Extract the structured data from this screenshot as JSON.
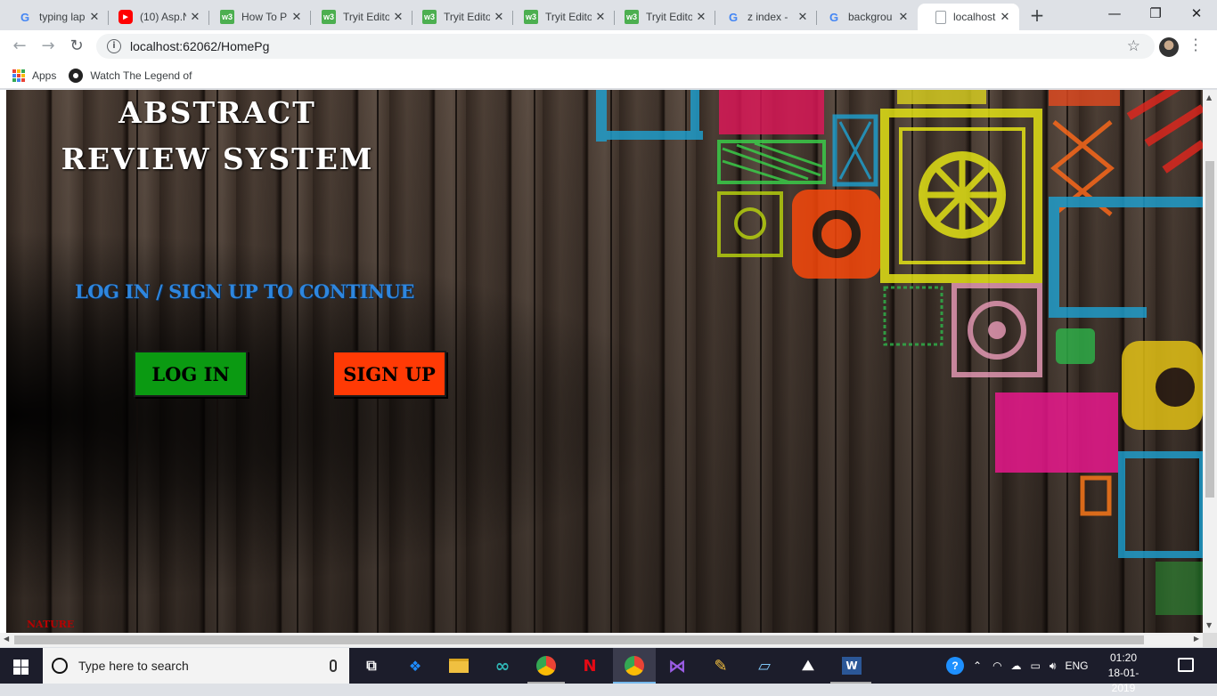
{
  "browser": {
    "tabs": [
      {
        "title": "typing lap",
        "favicon": "google-icon",
        "color": "#4285f4"
      },
      {
        "title": "(10) Asp.N",
        "favicon": "youtube-icon",
        "color": "#ff0000"
      },
      {
        "title": "How To P",
        "favicon": "w3schools-icon",
        "color": "#4caf50"
      },
      {
        "title": "Tryit Edito",
        "favicon": "w3schools-icon",
        "color": "#4caf50"
      },
      {
        "title": "Tryit Edito",
        "favicon": "w3schools-icon",
        "color": "#4caf50"
      },
      {
        "title": "Tryit Edito",
        "favicon": "w3schools-icon",
        "color": "#4caf50"
      },
      {
        "title": "Tryit Edito",
        "favicon": "w3schools-icon",
        "color": "#4caf50"
      },
      {
        "title": "z index -",
        "favicon": "google-icon",
        "color": "#4285f4"
      },
      {
        "title": "backgrou",
        "favicon": "google-icon",
        "color": "#4285f4"
      },
      {
        "title": "localhost",
        "favicon": "page-icon",
        "color": "#9aa0a6",
        "active": true
      }
    ],
    "new_tab": "+",
    "window_controls": {
      "minimize": "—",
      "maximize": "❐",
      "close": "✕"
    },
    "url": "localhost:62062/HomePg",
    "bookmarks": [
      {
        "label": "Apps",
        "icon": "apps-grid-icon"
      },
      {
        "label": "Watch The Legend of",
        "icon": "film-reel-icon"
      }
    ]
  },
  "page": {
    "title": "ABSTRACT   REVIEW SYSTEM",
    "prompt": "LOG IN / SIGN UP TO CONTINUE",
    "login_label": "LOG IN",
    "signup_label": "SIGN UP",
    "footer": "NATURE",
    "colors": {
      "prompt": "#2e86de",
      "login": "#0b9a12",
      "signup": "#ff3a05",
      "footer": "#b80000"
    }
  },
  "taskbar": {
    "search_placeholder": "Type here to search",
    "apps": [
      "task-view-icon",
      "dropbox-icon",
      "file-explorer-icon",
      "arduino-icon",
      "chrome-icon",
      "netflix-icon",
      "chrome-icon",
      "visual-studio-icon",
      "paint-icon",
      "notepad-icon",
      "photos-icon",
      "word-icon"
    ],
    "language": "ENG",
    "time": "01:20",
    "date": "18-01-2019"
  }
}
